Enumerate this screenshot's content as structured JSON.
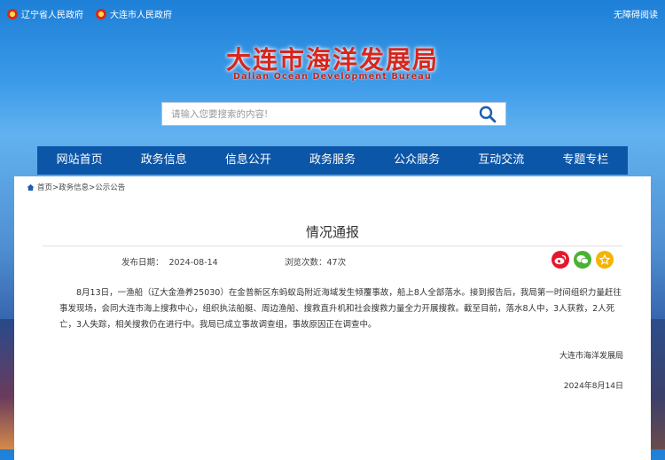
{
  "topbar": {
    "province_link": "辽宁省人民政府",
    "city_link": "大连市人民政府",
    "accessibility": "无障碍阅读"
  },
  "logo": {
    "cn": "大连市海洋发展局",
    "en": "Dalian Ocean Development Bureau"
  },
  "search": {
    "placeholder": "请输入您要搜索的内容!"
  },
  "nav": [
    "网站首页",
    "政务信息",
    "信息公开",
    "政务服务",
    "公众服务",
    "互动交流",
    "专题专栏"
  ],
  "breadcrumb": "首页>政务信息>公示公告",
  "article": {
    "title": "情况通报",
    "date_label": "发布日期：",
    "date": "2024-08-14",
    "views_label": "浏览次数：",
    "views": "47次",
    "body": "8月13日，一渔船（辽大金渔养25030）在金普新区东蚂蚁岛附近海域发生倾覆事故，船上8人全部落水。接到报告后，我局第一时间组织力量赶往事发现场，会同大连市海上搜救中心，组织执法船艇、周边渔船、搜救直升机和社会搜救力量全力开展搜救。截至目前，落水8人中，3人获救，2人死亡，3人失踪，相关搜救仍在进行中。我局已成立事故调查组，事故原因正在调查中。",
    "issuer": "大连市海洋发展局",
    "sign_date": "2024年8月14日"
  },
  "share_icons": [
    "weibo-icon",
    "wechat-icon",
    "favorite-icon"
  ],
  "colors": {
    "nav_bg": "#0c56a8",
    "logo_red": "#d8261c",
    "weibo": "#e6162d",
    "wechat": "#49b233",
    "favorite": "#f5b400"
  }
}
